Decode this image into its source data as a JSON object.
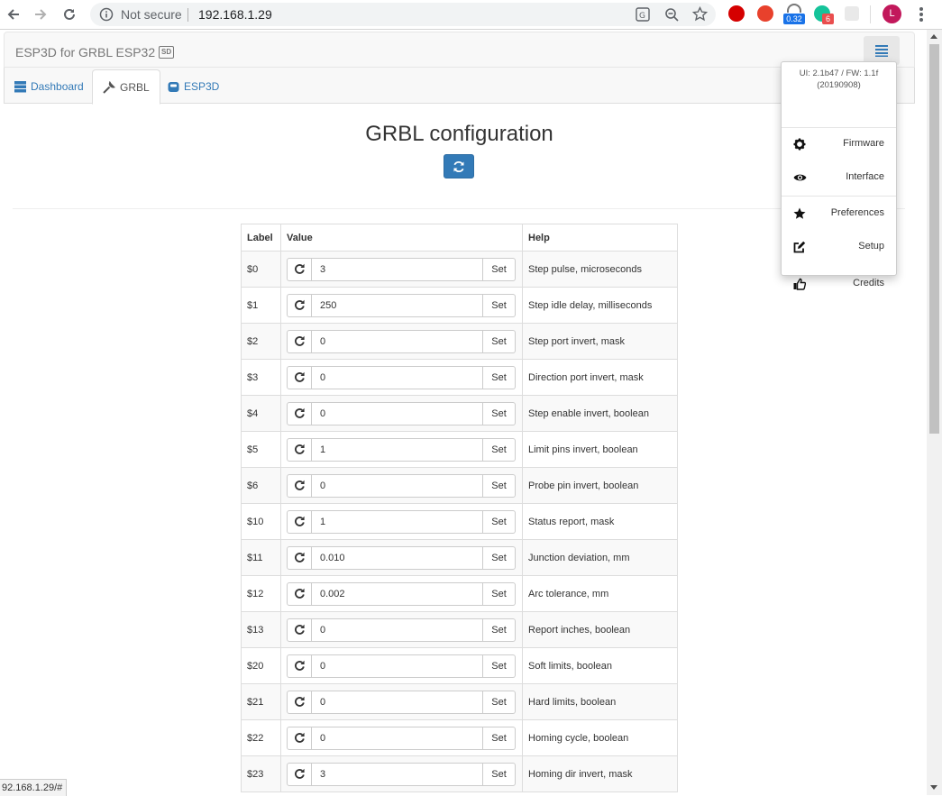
{
  "browser": {
    "security_label": "Not secure",
    "url": "192.168.1.29",
    "ext_badge_1": "0.32",
    "ext_badge_2": "6",
    "avatar_letter": "L",
    "status_url": "92.168.1.29/#"
  },
  "app": {
    "brand": "ESP3D for GRBL ESP32",
    "brand_badge": "SD"
  },
  "tabs": [
    {
      "label": "Dashboard"
    },
    {
      "label": "GRBL"
    },
    {
      "label": "ESP3D"
    }
  ],
  "main": {
    "title": "GRBL configuration"
  },
  "table": {
    "headers": {
      "label": "Label",
      "value": "Value",
      "help": "Help"
    },
    "set_label": "Set",
    "rows": [
      {
        "label": "$0",
        "value": "3",
        "help": "Step pulse, microseconds"
      },
      {
        "label": "$1",
        "value": "250",
        "help": "Step idle delay, milliseconds"
      },
      {
        "label": "$2",
        "value": "0",
        "help": "Step port invert, mask"
      },
      {
        "label": "$3",
        "value": "0",
        "help": "Direction port invert, mask"
      },
      {
        "label": "$4",
        "value": "0",
        "help": "Step enable invert, boolean"
      },
      {
        "label": "$5",
        "value": "1",
        "help": "Limit pins invert, boolean"
      },
      {
        "label": "$6",
        "value": "0",
        "help": "Probe pin invert, boolean"
      },
      {
        "label": "$10",
        "value": "1",
        "help": "Status report, mask"
      },
      {
        "label": "$11",
        "value": "0.010",
        "help": "Junction deviation, mm"
      },
      {
        "label": "$12",
        "value": "0.002",
        "help": "Arc tolerance, mm"
      },
      {
        "label": "$13",
        "value": "0",
        "help": "Report inches, boolean"
      },
      {
        "label": "$20",
        "value": "0",
        "help": "Soft limits, boolean"
      },
      {
        "label": "$21",
        "value": "0",
        "help": "Hard limits, boolean"
      },
      {
        "label": "$22",
        "value": "0",
        "help": "Homing cycle, boolean"
      },
      {
        "label": "$23",
        "value": "3",
        "help": "Homing dir invert, mask"
      }
    ]
  },
  "menu": {
    "version_line1": "UI: 2.1b47 / FW: 1.1f",
    "version_line2": "(20190908)",
    "items": [
      {
        "label": "Firmware",
        "icon": "gear-icon"
      },
      {
        "label": "Interface",
        "icon": "eye-icon"
      },
      {
        "label": "Preferences",
        "icon": "star-icon"
      },
      {
        "label": "Setup",
        "icon": "edit-icon"
      },
      {
        "label": "Credits",
        "icon": "thumbs-up-icon"
      }
    ]
  },
  "colors": {
    "primary": "#337ab7",
    "link": "#337ab7"
  }
}
